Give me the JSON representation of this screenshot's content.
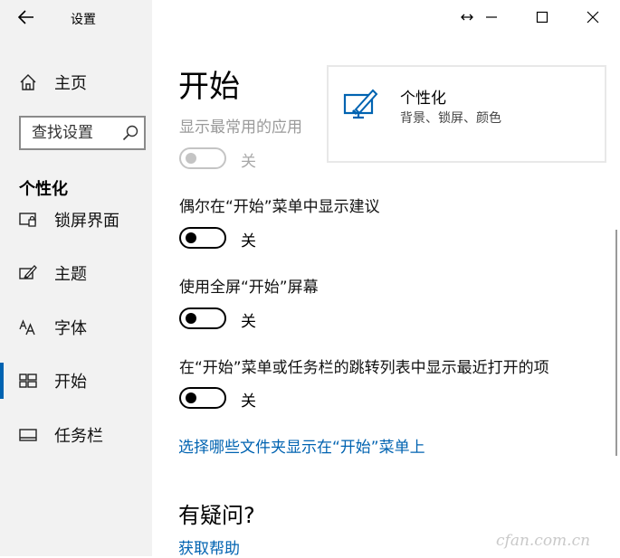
{
  "window": {
    "title": "设置",
    "back_icon": "back-arrow-icon",
    "controls": [
      "resize-icon",
      "minimize-icon",
      "maximize-icon",
      "close-icon"
    ]
  },
  "sidebar": {
    "home": {
      "label": "主页",
      "icon": "home-icon"
    },
    "search": {
      "placeholder": "查找设置",
      "icon": "search-icon"
    },
    "section_title": "个性化",
    "items": [
      {
        "label": "锁屏界面",
        "icon": "lock-screen-icon",
        "selected": false
      },
      {
        "label": "主题",
        "icon": "theme-brush-icon",
        "selected": false
      },
      {
        "label": "字体",
        "icon": "font-icon",
        "selected": false
      },
      {
        "label": "开始",
        "icon": "start-tiles-icon",
        "selected": true
      },
      {
        "label": "任务栏",
        "icon": "taskbar-icon",
        "selected": false
      }
    ]
  },
  "main": {
    "title": "开始",
    "settings": [
      {
        "label": "显示最常用的应用",
        "state": "关",
        "on": false,
        "disabled": true
      },
      {
        "label": "偶尔在“开始”菜单中显示建议",
        "state": "关",
        "on": false,
        "disabled": false
      },
      {
        "label": "使用全屏“开始”屏幕",
        "state": "关",
        "on": false,
        "disabled": false
      },
      {
        "label": "在“开始”菜单或任务栏的跳转列表中显示最近打开的项",
        "state": "关",
        "on": false,
        "disabled": false
      }
    ],
    "folders_link": "选择哪些文件夹显示在“开始”菜单上",
    "help_title": "有疑问?",
    "help_link": "获取帮助"
  },
  "related": {
    "title": "个性化",
    "subtitle": "背景、锁屏、颜色",
    "icon": "personalization-icon"
  },
  "watermark": "cfan.com.cn",
  "colors": {
    "accent": "#0063b1",
    "sidebar_bg": "#f2f2f2",
    "disabled": "#9a9a9a"
  }
}
